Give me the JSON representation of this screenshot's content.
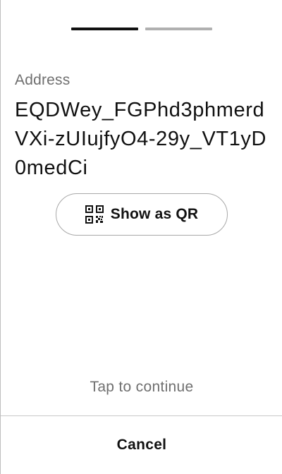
{
  "progress": {
    "steps_total": 2,
    "current_step": 1,
    "active_color": "#111111",
    "inactive_color": "#b0b0b0"
  },
  "address": {
    "label": "Address",
    "value": "EQDWey_FGPhd3phmerdVXi-zUIujfyO4-29y_VT1yD0medCi"
  },
  "qr_button": {
    "icon": "qr-code-icon",
    "label": "Show as QR"
  },
  "hint": {
    "text": "Tap to continue"
  },
  "footer": {
    "cancel_label": "Cancel"
  }
}
